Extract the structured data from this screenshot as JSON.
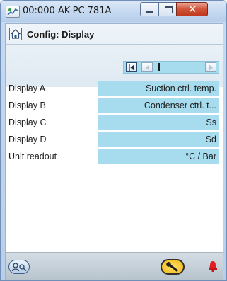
{
  "window": {
    "title": "00:000 AK-PC 781A",
    "close_glyph": "✕"
  },
  "header": {
    "page_title": "Config: Display"
  },
  "pager": {
    "icons": [
      "first-page-icon",
      "previous-page-icon",
      "next-page-icon"
    ]
  },
  "parameters": [
    {
      "label": "Display A",
      "value": "Suction ctrl. temp."
    },
    {
      "label": "Display B",
      "value": "Condenser ctrl. t..."
    },
    {
      "label": "Display C",
      "value": "Ss"
    },
    {
      "label": "Display D",
      "value": "Sd"
    },
    {
      "label": "Unit readout",
      "value": "°C / Bar"
    }
  ],
  "footer": {
    "icons": [
      "login-icon",
      "service-tool-icon",
      "alarm-bell-icon"
    ]
  },
  "colors": {
    "value_cell": "#a7dcee",
    "title_close": "#c0391e",
    "tool_button": "#f2b70f",
    "alarm": "#e02020"
  }
}
